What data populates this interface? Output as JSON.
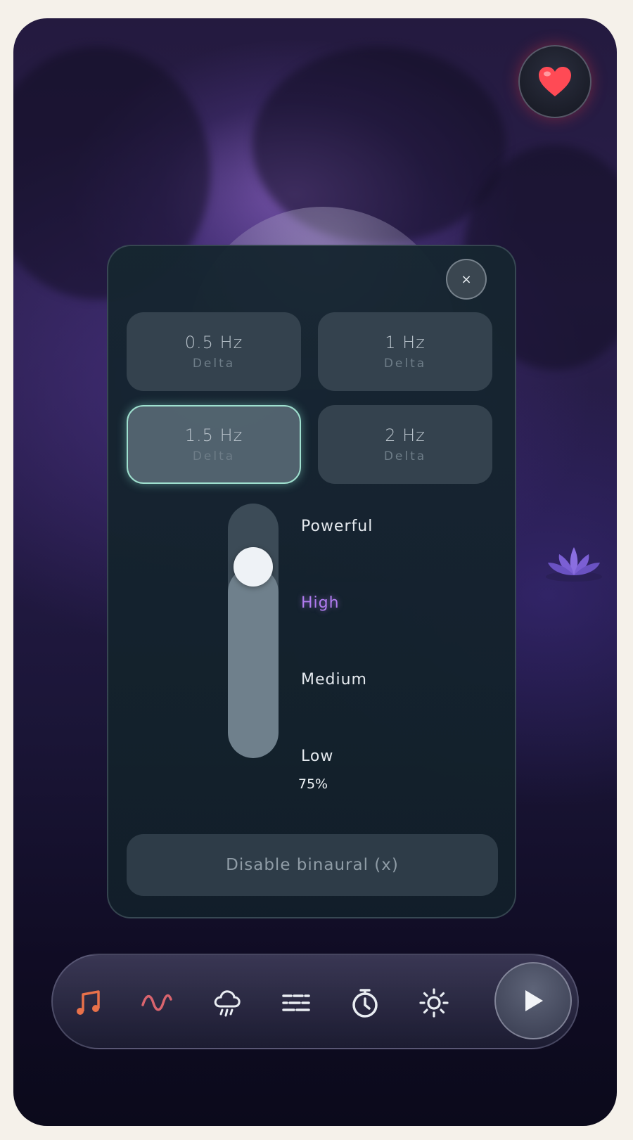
{
  "close_label": "×",
  "frequencies": [
    {
      "hz": "0.5 Hz",
      "band": "Delta"
    },
    {
      "hz": "1 Hz",
      "band": "Delta"
    },
    {
      "hz": "1.5 Hz",
      "band": "Delta"
    },
    {
      "hz": "2 Hz",
      "band": "Delta"
    }
  ],
  "selected_frequency": "1.5 Hz",
  "intensity": {
    "levels": [
      "Powerful",
      "High",
      "Medium",
      "Low"
    ],
    "selected": "High",
    "value_percent": 75,
    "percent_label": "75%"
  },
  "disable_button_label": "Disable binaural (x)",
  "bottom_bar": {
    "icons": [
      "music-note-icon",
      "wave-icon",
      "rain-cloud-icon",
      "wind-lines-icon",
      "timer-icon",
      "brightness-icon"
    ],
    "active_icon": "music-note-icon"
  },
  "colors": {
    "accent_selected_border": "#9fe0cf",
    "active_level": "#b17cf0",
    "music_icon": "#e8714a",
    "wave_icon": "#d9646e",
    "favorite": "#ff4a55"
  }
}
